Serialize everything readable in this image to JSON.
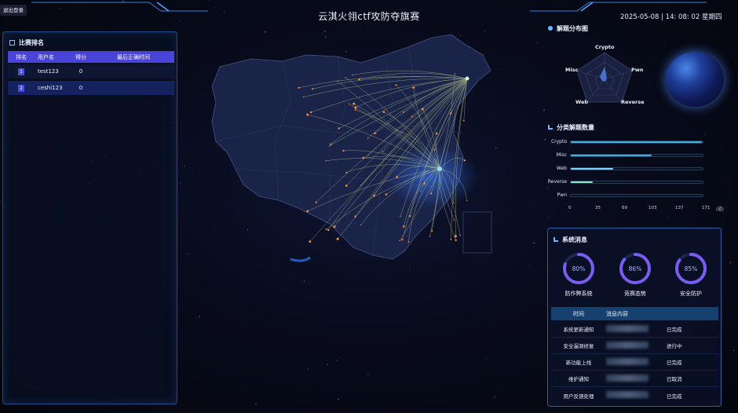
{
  "header": {
    "logout_label": "退出登录",
    "title": "云淇火翎ctf攻防夺旗赛",
    "datetime": "2025-05-08 | 14: 08: 02 星期四"
  },
  "ranking": {
    "title": "比赛排名",
    "columns": [
      "排名",
      "用户名",
      "得分",
      "最后正确时间"
    ],
    "rows": [
      {
        "rank": "1",
        "user": "test123",
        "score": "0",
        "time": ""
      },
      {
        "rank": "2",
        "user": "ceshi123",
        "score": "0",
        "time": ""
      }
    ]
  },
  "radar": {
    "title": "解题分布图",
    "axes": [
      "Crypto",
      "Pwn",
      "Reverse",
      "Web",
      "Misc"
    ]
  },
  "category_chart": {
    "title": "分类解题数量",
    "unit": "(道)",
    "chart_data": {
      "type": "bar",
      "orientation": "horizontal",
      "categories": [
        "Crypto",
        "Misc",
        "Web",
        "Reverse",
        "Pwn"
      ],
      "values": [
        170,
        105,
        55,
        28,
        0
      ],
      "xlim": [
        0,
        171
      ],
      "ticks": [
        "0",
        "35",
        "69",
        "103",
        "137",
        "171"
      ],
      "colors": [
        "#3fb3e0",
        "#3fb3e0",
        "#7fd3ff",
        "#8fe6b8",
        "#3fb3e0"
      ]
    }
  },
  "system_messages": {
    "title": "系统消息",
    "gauges": [
      {
        "value": "80%",
        "label": "防作弊系统",
        "fraction": 0.8
      },
      {
        "value": "86%",
        "label": "竞赛态势",
        "fraction": 0.86
      },
      {
        "value": "85%",
        "label": "安全防护",
        "fraction": 0.85
      }
    ],
    "columns": [
      "时间",
      "消息内容"
    ],
    "rows": [
      {
        "time": "系统更新通知",
        "status": "已完成"
      },
      {
        "time": "安全漏洞修复",
        "status": "进行中"
      },
      {
        "time": "新功能上线",
        "status": "已完成"
      },
      {
        "time": "维护通知",
        "status": "已取消"
      },
      {
        "time": "用户反馈处理",
        "status": "已完成"
      }
    ]
  },
  "colors": {
    "accent": "#4a43d9",
    "panel_border": "#1f4d8a",
    "gauge": "#7b5cf0",
    "map_line": "#e8f4a0",
    "map_point": "#ff8a3d"
  }
}
